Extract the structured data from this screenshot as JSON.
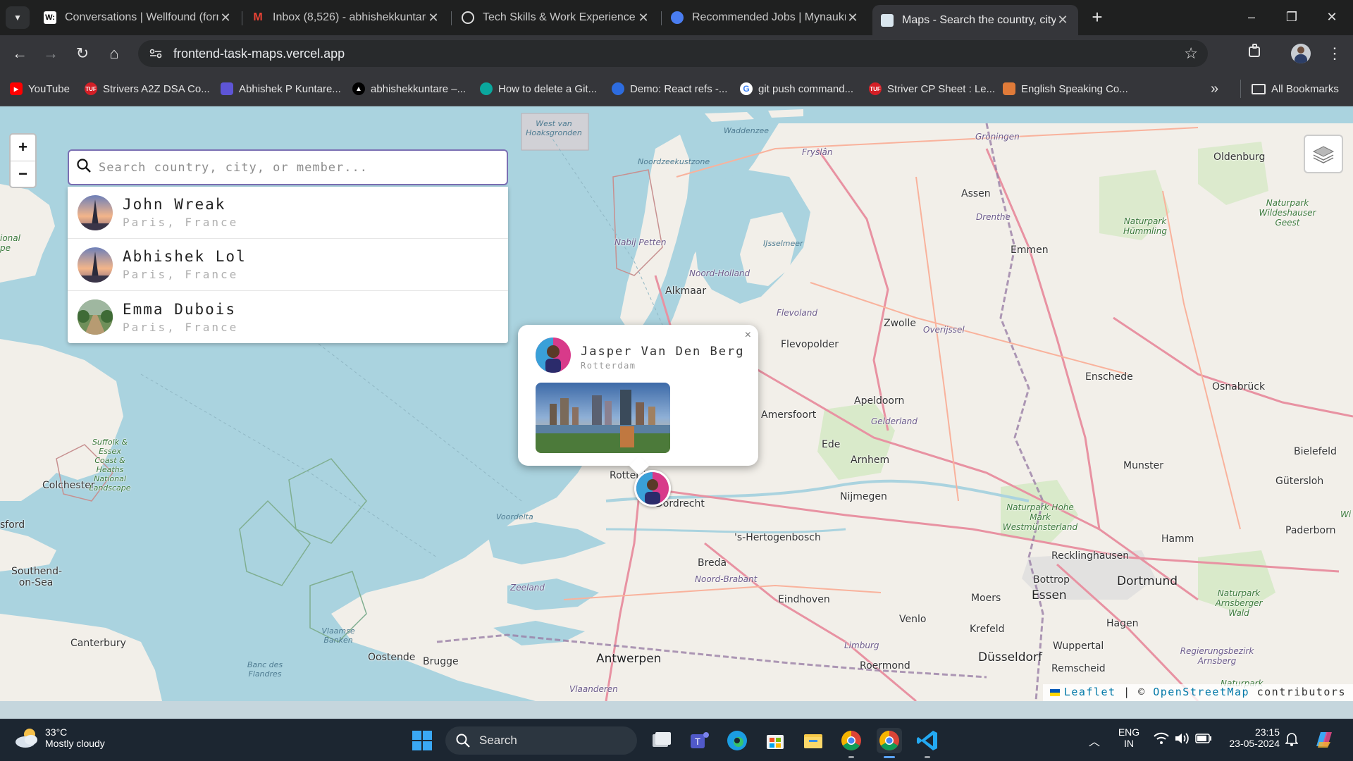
{
  "browser": {
    "tab_list_icon": "chevron-down-icon",
    "tabs": [
      {
        "title": "Conversations | Wellfound (form",
        "icon": "wellfound-icon",
        "favicon_text": "W:",
        "color": "#ffffff"
      },
      {
        "title": "Inbox (8,526) - abhishekkuntare",
        "icon": "gmail-icon",
        "favicon_text": "M",
        "color": "#ea4335"
      },
      {
        "title": "Tech Skills & Work Experience",
        "icon": "chatgpt-icon",
        "favicon_text": "",
        "color": "#ffffff"
      },
      {
        "title": "Recommended Jobs | Mynaukri",
        "icon": "naukri-icon",
        "favicon_text": "",
        "color": "#4a7df0"
      },
      {
        "title": "Maps - Search the country, city,",
        "icon": "maps-icon",
        "favicon_text": "",
        "color": "#8fb3c4",
        "active": true
      }
    ],
    "new_tab_label": "+",
    "window_controls": {
      "minimize": "–",
      "restore": "❐",
      "close": "✕"
    },
    "url": "frontend-task-maps.vercel.app",
    "bookmarks": [
      {
        "label": "YouTube",
        "icon": "youtube-icon",
        "color": "#ff0000",
        "badge": "▶"
      },
      {
        "label": "Strivers A2Z DSA Co...",
        "icon": "tuf-icon",
        "color": "#d31f26",
        "badge": "TUF"
      },
      {
        "label": "Abhishek P Kuntare...",
        "icon": "notion-icon",
        "color": "#5e55d6",
        "badge": ""
      },
      {
        "label": "abhishekkuntare –...",
        "icon": "vercel-icon",
        "color": "#000000",
        "badge": "▲"
      },
      {
        "label": "How to delete a Git...",
        "icon": "link-icon",
        "color": "#0aa89e",
        "badge": ""
      },
      {
        "label": "Demo: React refs -...",
        "icon": "codepen-icon",
        "color": "#2d6cdf",
        "badge": ""
      },
      {
        "label": "git push command...",
        "icon": "google-icon",
        "color": "#ffffff",
        "badge": "G"
      },
      {
        "label": "Striver CP Sheet : Le...",
        "icon": "tuf-icon",
        "color": "#d31f26",
        "badge": "TUF"
      },
      {
        "label": "English Speaking Co...",
        "icon": "bookmark-page-icon",
        "color": "#e07b39",
        "badge": ""
      }
    ],
    "more_bookmarks": "»",
    "all_bookmarks": "All Bookmarks"
  },
  "map": {
    "zoom_in": "+",
    "zoom_out": "−",
    "search_placeholder": "Search country, city, or member...",
    "results": [
      {
        "name": "John Wreak",
        "location": "Paris, France",
        "avatar": "eiffel"
      },
      {
        "name": "Abhishek Lol",
        "location": "Paris, France",
        "avatar": "eiffel"
      },
      {
        "name": "Emma Dubois",
        "location": "Paris, France",
        "avatar": "road"
      }
    ],
    "popup": {
      "name": "Jasper Van Den Berg",
      "city": "Rotterdam",
      "close": "×"
    },
    "attribution": {
      "leaflet": "Leaflet",
      "sep": "|",
      "copy": "©",
      "osm": "OpenStreetMap",
      "contributors": "contributors"
    },
    "labels": [
      {
        "text": "Waddenzee",
        "cls": "water"
      },
      {
        "text": "West van Hoaksgronden",
        "cls": "water"
      },
      {
        "text": "Noordzeekustzone",
        "cls": "water"
      },
      {
        "text": "Fryslân",
        "cls": "region"
      },
      {
        "text": "Groningen",
        "cls": "region"
      },
      {
        "text": "Oldenburg",
        "cls": "city"
      },
      {
        "text": "Assen",
        "cls": "city"
      },
      {
        "text": "Drenthe",
        "cls": "region"
      },
      {
        "text": "Naturpark Wildeshauser Geest",
        "cls": "park"
      },
      {
        "text": "Naturpark Hümmling",
        "cls": "park"
      },
      {
        "text": "Emmen",
        "cls": "city"
      },
      {
        "text": "Nabij Petten",
        "cls": "region"
      },
      {
        "text": "IJsselmeer",
        "cls": "water"
      },
      {
        "text": "Noord-Holland",
        "cls": "region"
      },
      {
        "text": "Alkmaar",
        "cls": "city"
      },
      {
        "text": "Flevoland",
        "cls": "region"
      },
      {
        "text": "Zwolle",
        "cls": "city"
      },
      {
        "text": "Overijssel",
        "cls": "region"
      },
      {
        "text": "Flevopolder",
        "cls": "city"
      },
      {
        "text": "Osnabrück",
        "cls": "city"
      },
      {
        "text": "Enschede",
        "cls": "city"
      },
      {
        "text": "Apeldoorn",
        "cls": "city"
      },
      {
        "text": "Gelderland",
        "cls": "region"
      },
      {
        "text": "Amersfoort",
        "cls": "city"
      },
      {
        "text": "Ede",
        "cls": "city"
      },
      {
        "text": "Arnhem",
        "cls": "city"
      },
      {
        "text": "Bielefeld",
        "cls": "city"
      },
      {
        "text": "Munster",
        "cls": "city"
      },
      {
        "text": "Gütersloh",
        "cls": "city"
      },
      {
        "text": "Nijmegen",
        "cls": "city"
      },
      {
        "text": "Naturpark Hohe Mark Westmünsterland",
        "cls": "park"
      },
      {
        "text": "Paderborn",
        "cls": "city"
      },
      {
        "text": "Hamm",
        "cls": "city"
      },
      {
        "text": "Rotterdam",
        "cls": "city"
      },
      {
        "text": "Dordrecht",
        "cls": "city"
      },
      {
        "text": "Voordelta",
        "cls": "water"
      },
      {
        "text": "'s-Hertogenbosch",
        "cls": "city"
      },
      {
        "text": "Breda",
        "cls": "city"
      },
      {
        "text": "Noord-Brabant",
        "cls": "region"
      },
      {
        "text": "Recklinghausen",
        "cls": "city"
      },
      {
        "text": "Dortmund",
        "cls": "bigcity"
      },
      {
        "text": "Bottrop",
        "cls": "city"
      },
      {
        "text": "Essen",
        "cls": "bigcity"
      },
      {
        "text": "Zeeland",
        "cls": "region"
      },
      {
        "text": "Eindhoven",
        "cls": "city"
      },
      {
        "text": "Moers",
        "cls": "city"
      },
      {
        "text": "Naturpark Arnsberger Wald",
        "cls": "park"
      },
      {
        "text": "Hagen",
        "cls": "city"
      },
      {
        "text": "Venlo",
        "cls": "city"
      },
      {
        "text": "Krefeld",
        "cls": "city"
      },
      {
        "text": "Wuppertal",
        "cls": "city"
      },
      {
        "text": "Limburg",
        "cls": "region"
      },
      {
        "text": "Roermond",
        "cls": "city"
      },
      {
        "text": "Düsseldorf",
        "cls": "bigcity"
      },
      {
        "text": "Remscheid",
        "cls": "city"
      },
      {
        "text": "Regierungsbezirk Arnsberg",
        "cls": "region"
      },
      {
        "text": "Naturpark",
        "cls": "park"
      },
      {
        "text": "Antwerpen",
        "cls": "bigcity"
      },
      {
        "text": "Vlaanderen",
        "cls": "region"
      },
      {
        "text": "Brugge",
        "cls": "city"
      },
      {
        "text": "Oostende",
        "cls": "city"
      },
      {
        "text": "Vlaamse Banken",
        "cls": "water"
      },
      {
        "text": "Banc des Flandres",
        "cls": "water"
      },
      {
        "text": "Canterbury",
        "cls": "city"
      },
      {
        "text": "Southend-on-Sea",
        "cls": "city"
      },
      {
        "text": "Colchester",
        "cls": "city"
      },
      {
        "text": "Suffolk & Essex Coast & Heaths National Landscape",
        "cls": "park"
      },
      {
        "text": "ional pe",
        "cls": "park"
      },
      {
        "text": "sford",
        "cls": "city"
      },
      {
        "text": "Wi",
        "cls": "park"
      }
    ]
  },
  "taskbar": {
    "weather_temp": "33°C",
    "weather_desc": "Mostly cloudy",
    "search_label": "Search",
    "lang_1": "ENG",
    "lang_2": "IN",
    "time": "23:15",
    "date": "23-05-2024",
    "apps": [
      "start-icon",
      "task-view-icon",
      "teams-icon",
      "edge-icon",
      "store-icon",
      "file-explorer-icon",
      "chrome-icon",
      "chrome-active-icon",
      "vscode-icon"
    ]
  }
}
